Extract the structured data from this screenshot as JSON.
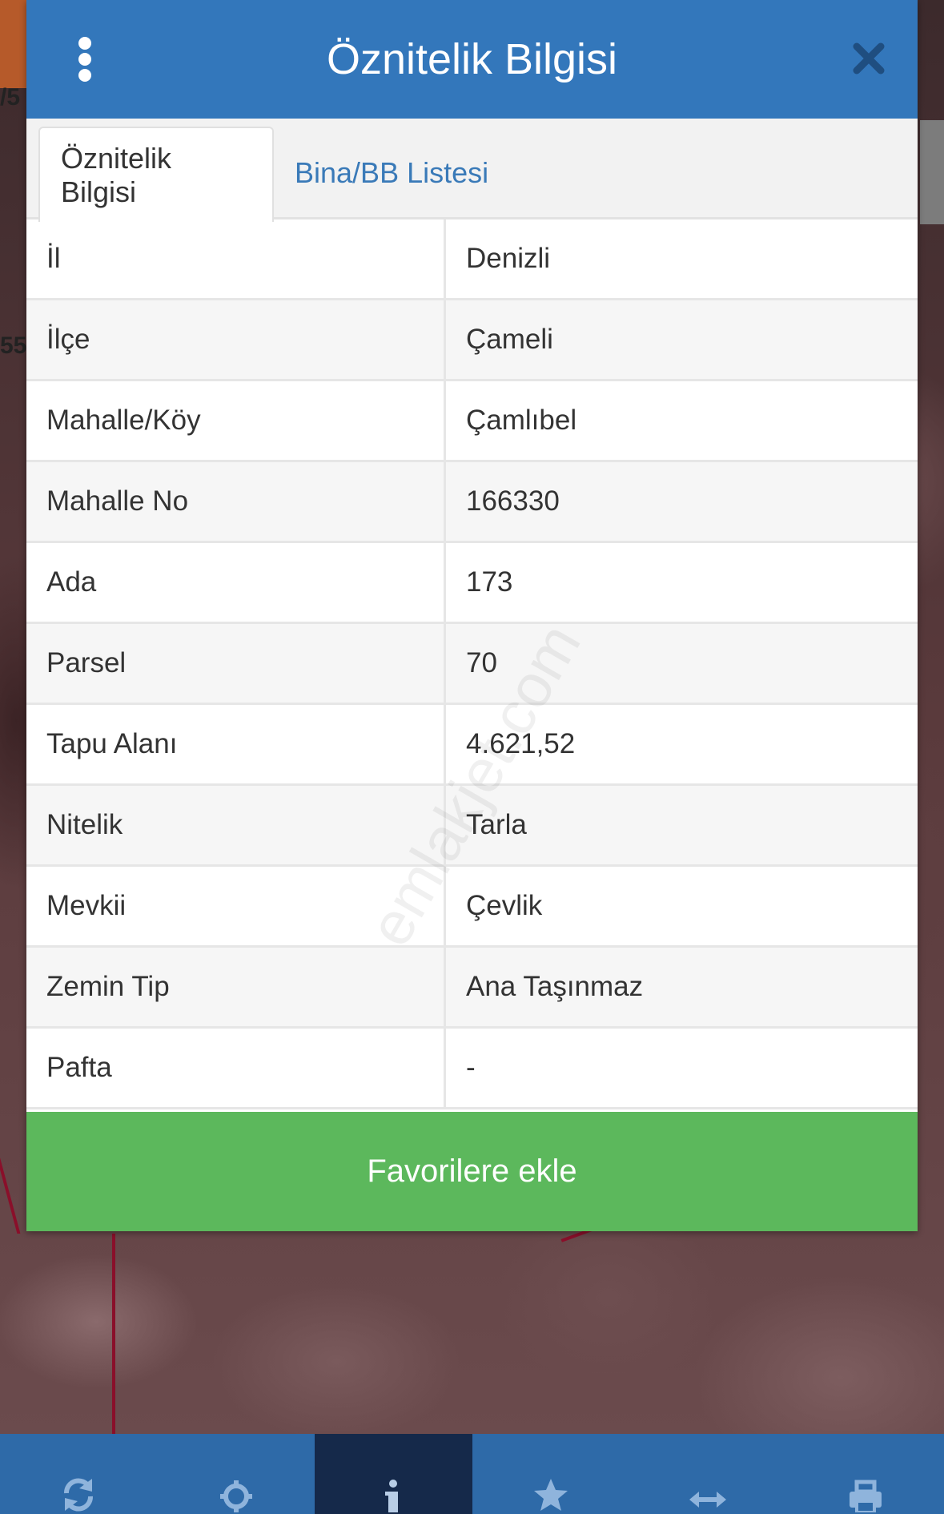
{
  "map": {
    "labels": [
      "/5",
      "55"
    ]
  },
  "dialog": {
    "title": "Öznitelik Bilgisi",
    "tabs": [
      {
        "label": "Öznitelik Bilgisi",
        "active": true
      },
      {
        "label": "Bina/BB Listesi",
        "active": false
      }
    ],
    "rows": [
      {
        "label": "İl",
        "value": "Denizli"
      },
      {
        "label": "İlçe",
        "value": "Çameli"
      },
      {
        "label": "Mahalle/Köy",
        "value": "Çamlıbel"
      },
      {
        "label": "Mahalle No",
        "value": "166330"
      },
      {
        "label": "Ada",
        "value": "173"
      },
      {
        "label": "Parsel",
        "value": "70"
      },
      {
        "label": "Tapu Alanı",
        "value": "4.621,52"
      },
      {
        "label": "Nitelik",
        "value": "Tarla"
      },
      {
        "label": "Mevkii",
        "value": "Çevlik"
      },
      {
        "label": "Zemin Tip",
        "value": "Ana Taşınmaz"
      },
      {
        "label": "Pafta",
        "value": "-"
      }
    ],
    "favorite_button": "Favorilere ekle",
    "watermark": "emlakjet.com"
  },
  "toolbar": {
    "items": [
      {
        "icon": "refresh-icon",
        "active": false
      },
      {
        "icon": "crosshair-icon",
        "active": false
      },
      {
        "icon": "info-icon",
        "active": true
      },
      {
        "icon": "star-icon",
        "active": false
      },
      {
        "icon": "measure-icon",
        "active": false
      },
      {
        "icon": "print-icon",
        "active": false
      }
    ]
  },
  "colors": {
    "header": "#3377bb",
    "tab_active_text": "#333333",
    "tab_link": "#3a7ab8",
    "favorite_button": "#5cb85c",
    "toolbar": "#2e6aa8",
    "toolbar_active": "#15294a"
  }
}
